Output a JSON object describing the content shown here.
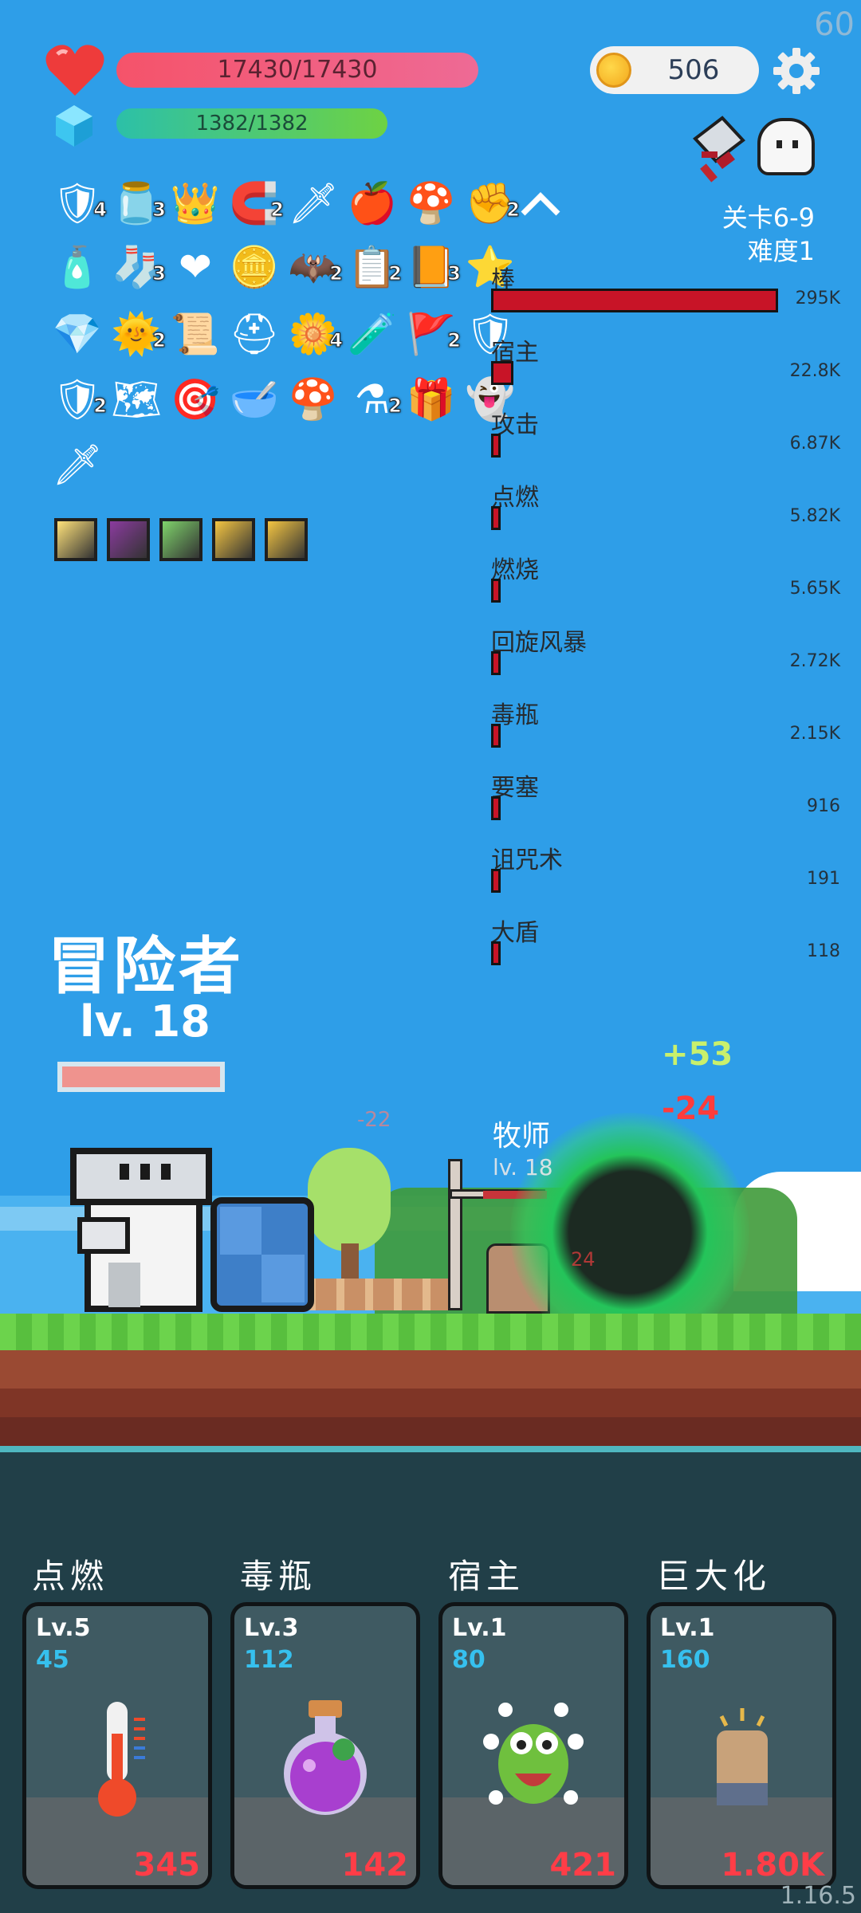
{
  "fps": "60",
  "hp": {
    "text": "17430/17430"
  },
  "mana": {
    "text": "1382/1382"
  },
  "coins": "506",
  "stage": {
    "level": "关卡6-9",
    "difficulty": "难度1"
  },
  "items": {
    "row1": [
      {
        "icon": "shield-round-icon",
        "glyph": "🛡",
        "badge": "4"
      },
      {
        "icon": "jam-jar-icon",
        "glyph": "🫙",
        "badge": "3"
      },
      {
        "icon": "crown-icon",
        "glyph": "👑",
        "badge": ""
      },
      {
        "icon": "magnet-icon",
        "glyph": "🧲",
        "badge": "2"
      },
      {
        "icon": "sword-icon",
        "glyph": "🗡",
        "badge": ""
      },
      {
        "icon": "apple-icon",
        "glyph": "🍎",
        "badge": ""
      },
      {
        "icon": "mushroom-icon",
        "glyph": "🍄",
        "badge": ""
      },
      {
        "icon": "arm-icon",
        "glyph": "✊",
        "badge": "2"
      }
    ],
    "row2": [
      {
        "icon": "spray-bottle-icon",
        "glyph": "🧴",
        "badge": ""
      },
      {
        "icon": "sock-icon",
        "glyph": "🧦",
        "badge": "3"
      },
      {
        "icon": "heart-item-icon",
        "glyph": "❤",
        "badge": ""
      },
      {
        "icon": "coin-stack-icon",
        "glyph": "🪙",
        "badge": ""
      },
      {
        "icon": "bat-icon",
        "glyph": "🦇",
        "badge": "2"
      },
      {
        "icon": "clipboard-icon",
        "glyph": "📋",
        "badge": "2"
      },
      {
        "icon": "book-icon",
        "glyph": "📙",
        "badge": "3"
      },
      {
        "icon": "star-card-icon",
        "glyph": "⭐",
        "badge": ""
      }
    ],
    "row3": [
      {
        "icon": "gem-icon",
        "glyph": "💎",
        "badge": ""
      },
      {
        "icon": "sun-orb-icon",
        "glyph": "🌞",
        "badge": "2"
      },
      {
        "icon": "scroll-icon",
        "glyph": "📜",
        "badge": ""
      },
      {
        "icon": "helmet-icon",
        "glyph": "⛑",
        "badge": ""
      },
      {
        "icon": "flower-icon",
        "glyph": "🌼",
        "badge": "4"
      },
      {
        "icon": "potion-icon",
        "glyph": "🧪",
        "badge": ""
      },
      {
        "icon": "flag-icon",
        "glyph": "🚩",
        "badge": "2"
      },
      {
        "icon": "red-shield-icon",
        "glyph": "🛡",
        "badge": ""
      }
    ],
    "row4": [
      {
        "icon": "blue-shield-icon",
        "glyph": "🛡",
        "badge": "2"
      },
      {
        "icon": "map-icon",
        "glyph": "🗺",
        "badge": ""
      },
      {
        "icon": "target-icon",
        "glyph": "🎯",
        "badge": ""
      },
      {
        "icon": "mortar-icon",
        "glyph": "🥣",
        "badge": ""
      },
      {
        "icon": "red-mushroom-icon",
        "glyph": "🍄",
        "badge": ""
      },
      {
        "icon": "cauldron-icon",
        "glyph": "⚗",
        "badge": "2"
      },
      {
        "icon": "chest-icon",
        "glyph": "🎁",
        "badge": ""
      },
      {
        "icon": "ghost-item-icon",
        "glyph": "👻",
        "badge": ""
      }
    ],
    "row5": [
      {
        "icon": "dagger-icon",
        "glyph": "🗡",
        "badge": ""
      }
    ],
    "skills": [
      {
        "icon": "light-skill-icon",
        "color": "#ffe27a"
      },
      {
        "icon": "demon-skill-icon",
        "color": "#8b3b9f"
      },
      {
        "icon": "heal-skill-icon",
        "color": "#7fd36b"
      },
      {
        "icon": "shield-skill-icon",
        "color": "#f4c542"
      },
      {
        "icon": "slash-skill-icon",
        "color": "#f4c542"
      }
    ]
  },
  "damage_meter": [
    {
      "label": "棒",
      "value": "295K",
      "fraction": 1.0
    },
    {
      "label": "宿主",
      "value": "22.8K",
      "fraction": 0.077
    },
    {
      "label": "攻击",
      "value": "6.87K",
      "fraction": 0.023
    },
    {
      "label": "点燃",
      "value": "5.82K",
      "fraction": 0.02
    },
    {
      "label": "燃烧",
      "value": "5.65K",
      "fraction": 0.019
    },
    {
      "label": "回旋风暴",
      "value": "2.72K",
      "fraction": 0.009
    },
    {
      "label": "毒瓶",
      "value": "2.15K",
      "fraction": 0.007
    },
    {
      "label": "要塞",
      "value": "916",
      "fraction": 0.003
    },
    {
      "label": "诅咒术",
      "value": "191",
      "fraction": 0.001
    },
    {
      "label": "大盾",
      "value": "118",
      "fraction": 0.0004
    }
  ],
  "player": {
    "name": "冒险者",
    "level": "lv. 18"
  },
  "floats": {
    "heal": "+53",
    "damage": "-24",
    "small": "-22",
    "enemy_hit": "24"
  },
  "enemy": {
    "name": "牧师",
    "level": "lv. 18"
  },
  "cards": [
    {
      "title": "点燃",
      "level": "Lv.5",
      "value": "45",
      "cost": "345",
      "art": "thermometer-icon"
    },
    {
      "title": "毒瓶",
      "level": "Lv.3",
      "value": "112",
      "cost": "142",
      "art": "poison-flask-icon"
    },
    {
      "title": "宿主",
      "level": "Lv.1",
      "value": "80",
      "cost": "421",
      "art": "green-monster-icon"
    },
    {
      "title": "巨大化",
      "level": "Lv.1",
      "value": "160",
      "cost": "1.80K",
      "art": "fist-icon"
    }
  ],
  "version": "1.16.5",
  "colors": {
    "sky": "#2e9ee8",
    "hp": "#f5536a",
    "mana": "#6ed243",
    "damage_bar": "#c81427",
    "cost": "#ff3d47",
    "level_value": "#36c0ee"
  }
}
